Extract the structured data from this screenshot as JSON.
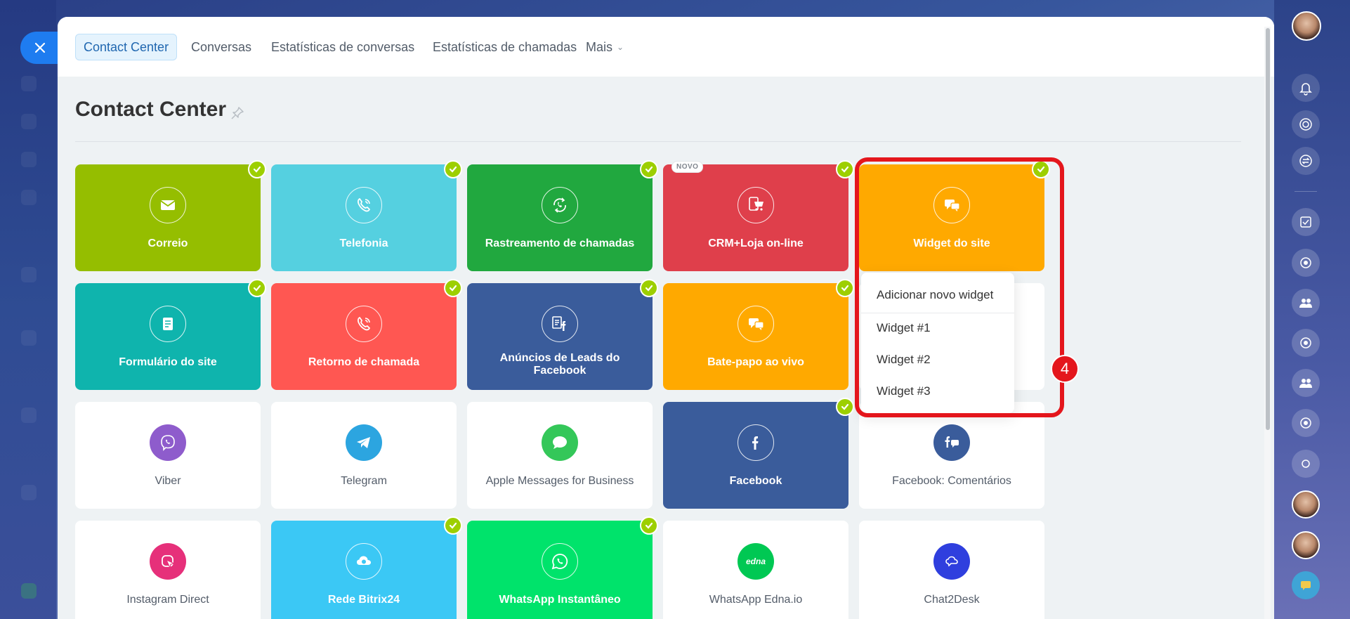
{
  "nav": {
    "tabs": [
      {
        "label": "Contact Center"
      },
      {
        "label": "Conversas"
      },
      {
        "label": "Estatísticas de conversas"
      },
      {
        "label": "Estatísticas de chamadas"
      },
      {
        "label": "Mais"
      }
    ]
  },
  "page": {
    "title": "Contact Center"
  },
  "tiles": [
    {
      "label": "Correio",
      "color": "#95be00",
      "icon": "envelope-icon"
    },
    {
      "label": "Telefonia",
      "color": "#55d0e0",
      "icon": "phone-icon"
    },
    {
      "label": "Rastreamento de chamadas",
      "color": "#21a83f",
      "icon": "call-tracking-icon"
    },
    {
      "label": "CRM+Loja on-line",
      "color": "#df3f4b",
      "icon": "cart-icon",
      "badge": "NOVO"
    },
    {
      "label": "Widget do site",
      "color": "#ffa900",
      "icon": "chat-bubbles-icon"
    },
    {
      "label": "Formulário do site",
      "color": "#0fb4ad",
      "icon": "form-icon"
    },
    {
      "label": "Retorno de chamada",
      "color": "#ff5752",
      "icon": "callback-icon"
    },
    {
      "label": "Anúncios de Leads do Facebook",
      "color": "#3a5c9b",
      "icon": "facebook-leads-icon"
    },
    {
      "label": "Bate-papo ao vivo",
      "color": "#ffa900",
      "icon": "live-chat-icon"
    },
    {
      "label": "Viber",
      "color": "#8e5ccc",
      "icon": "viber-icon"
    },
    {
      "label": "Telegram",
      "color": "#2ca5e0",
      "icon": "telegram-icon"
    },
    {
      "label": "Apple Messages for Business",
      "color": "#34c759",
      "icon": "apple-messages-icon"
    },
    {
      "label": "Facebook",
      "color": "#3a5c9b",
      "icon": "facebook-icon"
    },
    {
      "label": "Facebook: Comentários",
      "color": "#3a5c9b",
      "icon": "facebook-comments-icon"
    },
    {
      "label": "Instagram Direct",
      "color": "#e6307a",
      "icon": "instagram-direct-icon"
    },
    {
      "label": "Rede Bitrix24",
      "color": "#3bc8f5",
      "icon": "bitrix24-network-icon"
    },
    {
      "label": "WhatsApp Instantâneo",
      "color": "#00e36b",
      "icon": "whatsapp-icon"
    },
    {
      "label": "WhatsApp Edna.io",
      "color": "#00c853",
      "icon": "edna-icon",
      "icon_text": "edna"
    },
    {
      "label": "Chat2Desk",
      "color": "#2f3fde",
      "icon": "chat2desk-icon"
    }
  ],
  "dropdown": {
    "items": [
      {
        "label": "Adicionar novo widget"
      },
      {
        "label": "Widget #1"
      },
      {
        "label": "Widget #2"
      },
      {
        "label": "Widget #3"
      }
    ]
  },
  "annotation": {
    "step": "4",
    "color": "#e4161c"
  }
}
